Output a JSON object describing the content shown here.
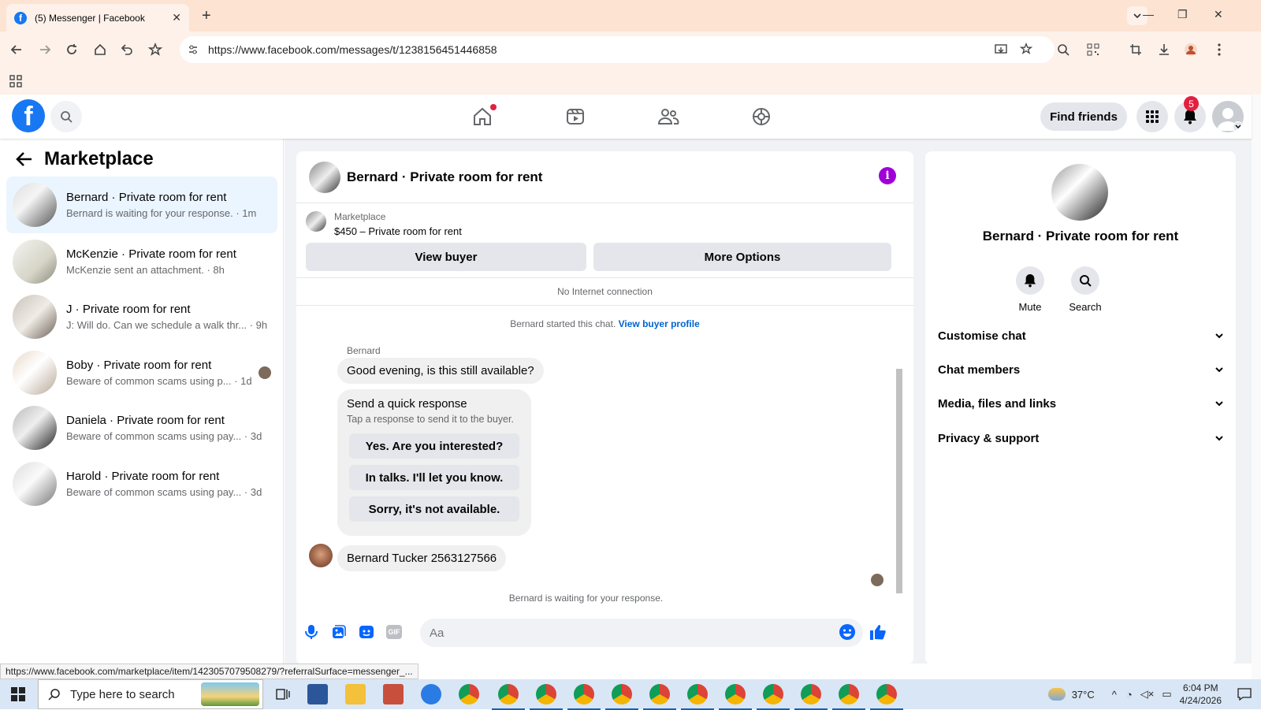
{
  "browser": {
    "tab_title": "(5) Messenger | Facebook",
    "url": "https://www.facebook.com/messages/t/1238156451446858"
  },
  "header": {
    "find_friends": "Find friends",
    "notification_count": "5"
  },
  "sidebar": {
    "title": "Marketplace",
    "conversations": [
      {
        "name": "Bernard · Private room for rent",
        "preview": "Bernard is waiting for your response. · 1m"
      },
      {
        "name": "McKenzie · Private room for rent",
        "preview": "McKenzie sent an attachment. · 8h"
      },
      {
        "name": "J · Private room for rent",
        "preview": "J: Will do. Can we schedule a walk thr... · 9h"
      },
      {
        "name": "Boby · Private room for rent",
        "preview": "Beware of common scams using p... · 1d"
      },
      {
        "name": "Daniela · Private room for rent",
        "preview": "Beware of common scams using pay... · 3d"
      },
      {
        "name": "Harold · Private room for rent",
        "preview": "Beware of common scams using pay... · 3d"
      }
    ]
  },
  "chat": {
    "title": "Bernard · Private room for rent",
    "listing_source": "Marketplace",
    "listing_title": "$450 – Private room for rent",
    "view_buyer": "View buyer",
    "more_options": "More Options",
    "no_internet": "No Internet connection",
    "started_text": "Bernard started this chat.",
    "view_buyer_profile": "View buyer profile",
    "sender_name": "Bernard",
    "message_1": "Good evening, is this still available?",
    "quick_title": "Send a quick response",
    "quick_subtitle": "Tap a response to send it to the buyer.",
    "quick_responses": [
      "Yes. Are you interested?",
      "In talks. I'll let you know.",
      "Sorry, it's not available."
    ],
    "message_2": "Bernard Tucker 2563127566",
    "waiting": "Bernard is waiting for your response.",
    "input_placeholder": "Aa",
    "gif_label": "GIF"
  },
  "details": {
    "name": "Bernard · Private room for rent",
    "mute": "Mute",
    "search": "Search",
    "sections": [
      "Customise chat",
      "Chat members",
      "Media, files and links",
      "Privacy & support"
    ]
  },
  "status_url": "https://www.facebook.com/marketplace/item/1423057079508279/?referralSurface=messenger_...",
  "taskbar": {
    "search_placeholder": "Type here to search",
    "weather": "37°C",
    "time": "6:04 PM",
    "date": "4/24/2026"
  },
  "colors": {
    "brand": "#1877f2",
    "info_accent": "#a000d8",
    "link": "#0064d1",
    "badge": "#e41e3f"
  }
}
